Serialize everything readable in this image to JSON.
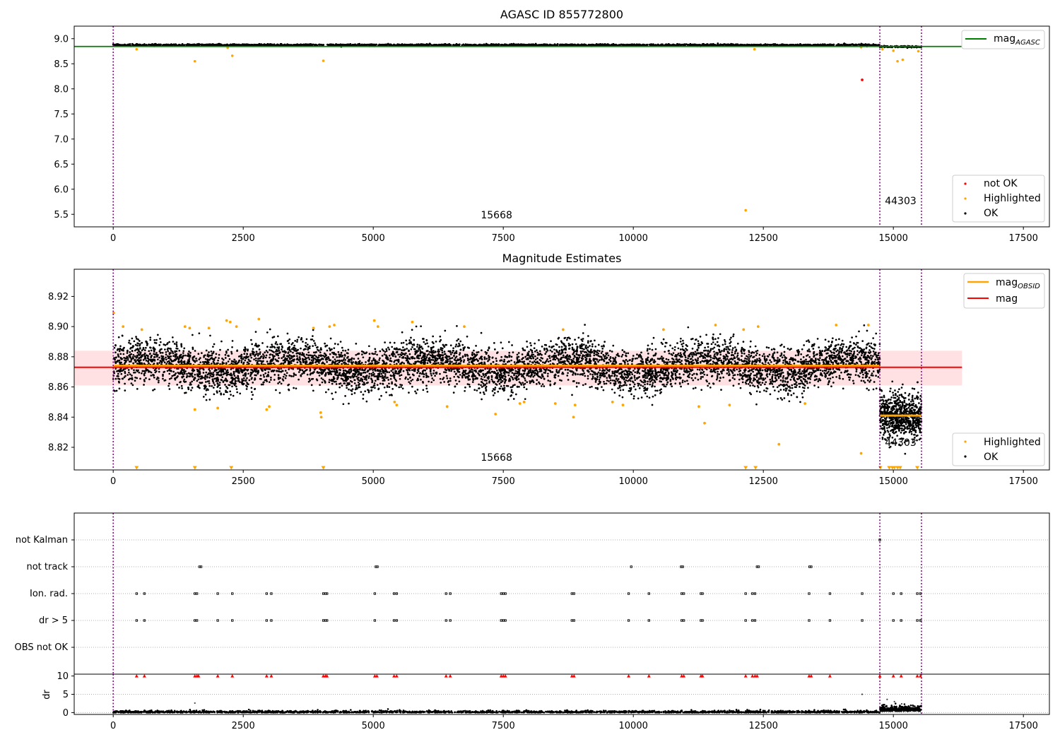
{
  "chart_data": [
    {
      "type": "scatter",
      "title": "AGASC ID 855772800",
      "xlabel": "",
      "ylabel": "",
      "xlim": [
        -750,
        18000
      ],
      "ylim": [
        5.25,
        9.25
      ],
      "x_ticks": [
        0,
        2500,
        5000,
        7500,
        10000,
        12500,
        15000,
        17500
      ],
      "y_ticks": [
        5.5,
        6.0,
        6.5,
        7.0,
        7.5,
        8.0,
        8.5,
        9.0
      ],
      "vlines": [
        0,
        14740,
        15540
      ],
      "annotations": [
        {
          "text": "15668",
          "x": 7370,
          "y": 5.42
        },
        {
          "text": "44303",
          "x": 15140,
          "y": 5.7
        }
      ],
      "hlines": [
        {
          "name": "mag",
          "sub": "AGASC",
          "y": 8.845,
          "x": [
            -750,
            16320
          ],
          "color": "#008000"
        }
      ],
      "band": {
        "y_mean": 8.875,
        "x": [
          0,
          15540
        ]
      },
      "series": [
        {
          "name": "not OK",
          "color": "#ff0000",
          "points": [
            [
              14400,
              8.18
            ]
          ]
        },
        {
          "name": "Highlighted",
          "color": "#ffa500",
          "points": [
            [
              450,
              8.79
            ],
            [
              1570,
              8.55
            ],
            [
              2200,
              8.82
            ],
            [
              2290,
              8.66
            ],
            [
              4040,
              8.56
            ],
            [
              12160,
              5.58
            ],
            [
              12330,
              8.79
            ],
            [
              14380,
              8.83
            ],
            [
              14790,
              8.79
            ],
            [
              15000,
              8.76
            ],
            [
              15080,
              8.55
            ],
            [
              15180,
              8.58
            ],
            [
              15480,
              8.75
            ]
          ]
        },
        {
          "name": "OK",
          "color": "#000000"
        }
      ],
      "legend": [
        "not OK",
        "Highlighted",
        "OK"
      ],
      "grid": false
    },
    {
      "type": "scatter",
      "title": "Magnitude Estimates",
      "xlabel": "",
      "ylabel": "",
      "xlim": [
        -750,
        18000
      ],
      "ylim": [
        8.805,
        8.938
      ],
      "x_ticks": [
        0,
        2500,
        5000,
        7500,
        10000,
        12500,
        15000,
        17500
      ],
      "y_ticks": [
        8.82,
        8.84,
        8.86,
        8.88,
        8.9,
        8.92
      ],
      "vlines": [
        0,
        14740,
        15540
      ],
      "annotations": [
        {
          "text": "15668",
          "x": 7370,
          "y": 8.811
        },
        {
          "text": "44303",
          "x": 15140,
          "y": 8.821
        }
      ],
      "mean_band": {
        "y": [
          8.861,
          8.884
        ],
        "x": [
          -750,
          16320
        ],
        "color": "#ffb0b8"
      },
      "lines": [
        {
          "name": "mag",
          "sub": "OBSID",
          "color": "#ffa500",
          "segments": [
            [
              0,
              14740,
              8.874
            ],
            [
              14740,
              15540,
              8.841
            ]
          ]
        },
        {
          "name": "mag",
          "color": "#ff0000",
          "segments": [
            [
              -750,
              16320,
              8.873
            ]
          ]
        }
      ],
      "series": [
        {
          "name": "Highlighted",
          "color": "#ffa500",
          "points": [
            [
              10,
              8.909
            ],
            [
              190,
              8.9
            ],
            [
              550,
              8.898
            ],
            [
              1380,
              8.9
            ],
            [
              1470,
              8.899
            ],
            [
              1570,
              8.845
            ],
            [
              1840,
              8.899
            ],
            [
              2010,
              8.846
            ],
            [
              2180,
              8.904
            ],
            [
              2250,
              8.903
            ],
            [
              2370,
              8.9
            ],
            [
              2800,
              8.905
            ],
            [
              2950,
              8.845
            ],
            [
              3000,
              8.847
            ],
            [
              3850,
              8.899
            ],
            [
              3990,
              8.843
            ],
            [
              4000,
              8.84
            ],
            [
              4160,
              8.9
            ],
            [
              4250,
              8.901
            ],
            [
              5020,
              8.904
            ],
            [
              5090,
              8.9
            ],
            [
              5410,
              8.85
            ],
            [
              5450,
              8.848
            ],
            [
              5750,
              8.903
            ],
            [
              6420,
              8.847
            ],
            [
              6750,
              8.9
            ],
            [
              7350,
              8.842
            ],
            [
              7820,
              8.849
            ],
            [
              7900,
              8.85
            ],
            [
              8500,
              8.849
            ],
            [
              8650,
              8.898
            ],
            [
              8850,
              8.84
            ],
            [
              8880,
              8.848
            ],
            [
              9600,
              8.85
            ],
            [
              9800,
              8.848
            ],
            [
              10580,
              8.898
            ],
            [
              11260,
              8.847
            ],
            [
              11370,
              8.836
            ],
            [
              11580,
              8.901
            ],
            [
              11850,
              8.848
            ],
            [
              12120,
              8.898
            ],
            [
              12400,
              8.9
            ],
            [
              12800,
              8.822
            ],
            [
              13300,
              8.849
            ],
            [
              13900,
              8.901
            ],
            [
              14380,
              8.816
            ],
            [
              14520,
              8.901
            ]
          ]
        },
        {
          "name": "OK",
          "color": "#000000"
        }
      ],
      "clipped_markers_x": [
        450,
        1570,
        2270,
        4040,
        12160,
        12350,
        14750,
        14920,
        14980,
        15020,
        15080,
        15130,
        15460
      ],
      "legend": [
        "Highlighted",
        "OK"
      ],
      "grid": false
    },
    {
      "type": "scatter",
      "title": "",
      "xlabel": "",
      "ylabel": "",
      "xlim": [
        -750,
        18000
      ],
      "flag_rows": [
        "not Kalman",
        "not track",
        "Ion. rad.",
        "dr > 5",
        "OBS not OK"
      ],
      "flags": {
        "not Kalman": [
          14740
        ],
        "not track": [
          1660,
          1690,
          5050,
          5080,
          9960,
          10920,
          10950,
          12380,
          12410,
          13390,
          13420
        ],
        "Ion. rad.": [
          450,
          600,
          1570,
          1610,
          2010,
          2290,
          2950,
          3040,
          4040,
          4080,
          4110,
          5030,
          5400,
          5450,
          6400,
          6480,
          7460,
          7500,
          7540,
          8820,
          8860,
          9910,
          10300,
          10930,
          10970,
          11300,
          11330,
          12160,
          12290,
          12340,
          13380,
          13780,
          14400,
          15000,
          15150,
          15460,
          15520
        ],
        "dr > 5": [
          450,
          600,
          1570,
          1610,
          2010,
          2290,
          2950,
          3040,
          4040,
          4080,
          4110,
          5030,
          5400,
          5450,
          6400,
          6480,
          7460,
          7500,
          7540,
          8820,
          8860,
          9910,
          10300,
          10930,
          10970,
          11300,
          11330,
          12160,
          12290,
          12340,
          13380,
          13780,
          14400,
          15000,
          15150,
          15460,
          15520
        ],
        "OBS not OK": []
      }
    },
    {
      "type": "scatter",
      "title": "",
      "xlabel": "",
      "ylabel": "dr",
      "xlim": [
        -750,
        18000
      ],
      "ylim": [
        -0.5,
        10.5
      ],
      "x_ticks": [
        0,
        2500,
        5000,
        7500,
        10000,
        12500,
        15000,
        17500
      ],
      "y_ticks": [
        0,
        5,
        10
      ],
      "vlines": [
        0,
        14740,
        15540
      ],
      "outliers_at_10": [
        450,
        600,
        1570,
        1610,
        1640,
        2010,
        2290,
        2950,
        3040,
        4040,
        4080,
        4110,
        5030,
        5070,
        5400,
        5450,
        6400,
        6480,
        7460,
        7500,
        7540,
        8820,
        8860,
        9910,
        10300,
        10930,
        10970,
        11300,
        11330,
        12160,
        12290,
        12340,
        12380,
        13380,
        13420,
        13780,
        14740,
        15000,
        15150,
        15460,
        15520
      ],
      "extra_points": [
        [
          1570,
          2.6
        ],
        [
          14400,
          5.0
        ],
        [
          14880,
          3.6
        ],
        [
          15020,
          3.0
        ],
        [
          15160,
          2.4
        ]
      ]
    }
  ]
}
